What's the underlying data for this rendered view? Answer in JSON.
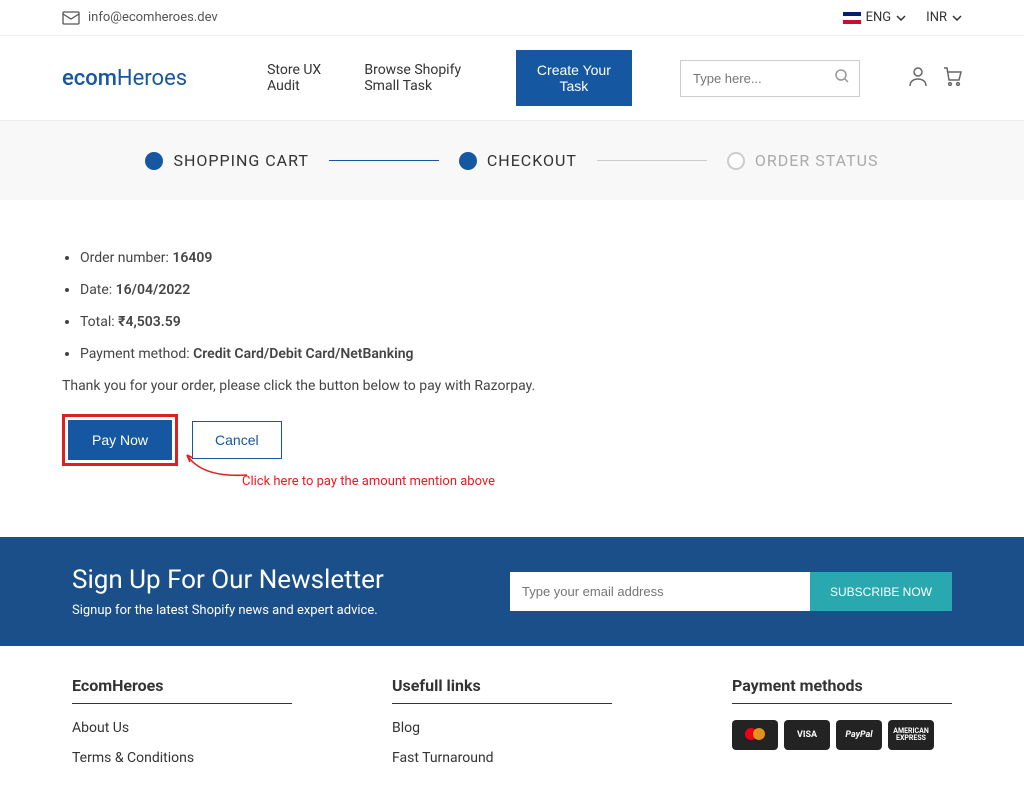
{
  "topbar": {
    "email": "info@ecomheroes.dev",
    "lang": "ENG",
    "currency": "INR"
  },
  "header": {
    "logo_part1": "ecom",
    "logo_part2": "Heroes",
    "nav": {
      "audit": "Store UX Audit",
      "browse": "Browse Shopify Small Task"
    },
    "cta": "Create Your Task",
    "search_placeholder": "Type here..."
  },
  "steps": {
    "cart": "SHOPPING CART",
    "checkout": "CHECKOUT",
    "status": "ORDER STATUS"
  },
  "order": {
    "number_label": "Order number: ",
    "number": "16409",
    "date_label": "Date: ",
    "date": "16/04/2022",
    "total_label": "Total:",
    "total_value": "4,503.59",
    "payment_label": "Payment method: ",
    "payment_value": "Credit Card/Debit Card/NetBanking",
    "thank_you": "Thank you for your order, please click the button below to pay with Razorpay.",
    "pay_now": "Pay Now",
    "cancel": "Cancel",
    "annotation": "Click here to pay the amount mention above"
  },
  "newsletter": {
    "title": "Sign Up For Our Newsletter",
    "subtitle": "Signup for the latest Shopify news and expert advice.",
    "placeholder": "Type your email address",
    "button": "SUBSCRIBE NOW"
  },
  "footer": {
    "col1_title": "EcomHeroes",
    "about": "About Us",
    "terms": "Terms & Conditions",
    "col2_title": "Usefull links",
    "blog": "Blog",
    "fast": "Fast Turnaround",
    "col3_title": "Payment methods",
    "mc": "mastercard",
    "visa": "VISA",
    "paypal": "PayPal",
    "amex": "AMERICAN EXPRESS"
  }
}
